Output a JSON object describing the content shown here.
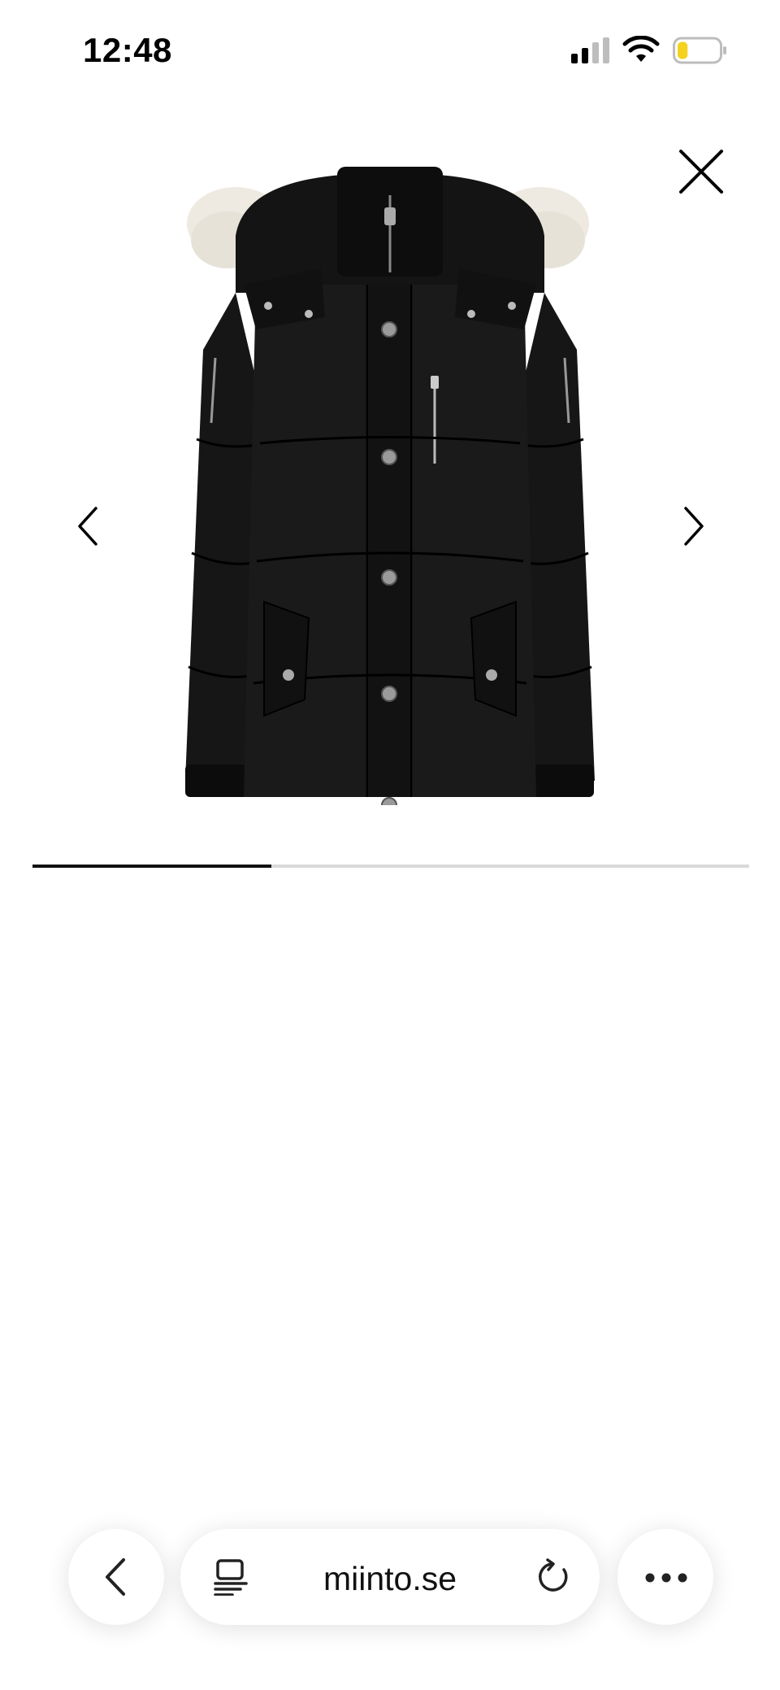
{
  "status_bar": {
    "time": "12:48",
    "icons": [
      "cellular-signal-icon",
      "wifi-icon",
      "battery-icon"
    ],
    "battery_level_fraction": 0.25,
    "battery_color": "#f5d21e"
  },
  "gallery": {
    "product_image": "black-down-parka-with-fur-hood",
    "controls": [
      "close-icon",
      "chevron-left-icon",
      "chevron-right-icon"
    ],
    "progress_fraction": 0.333
  },
  "browser_bar": {
    "url": "miinto.se",
    "icons": [
      "back-icon",
      "reader-view-icon",
      "reload-icon",
      "more-icon"
    ]
  }
}
